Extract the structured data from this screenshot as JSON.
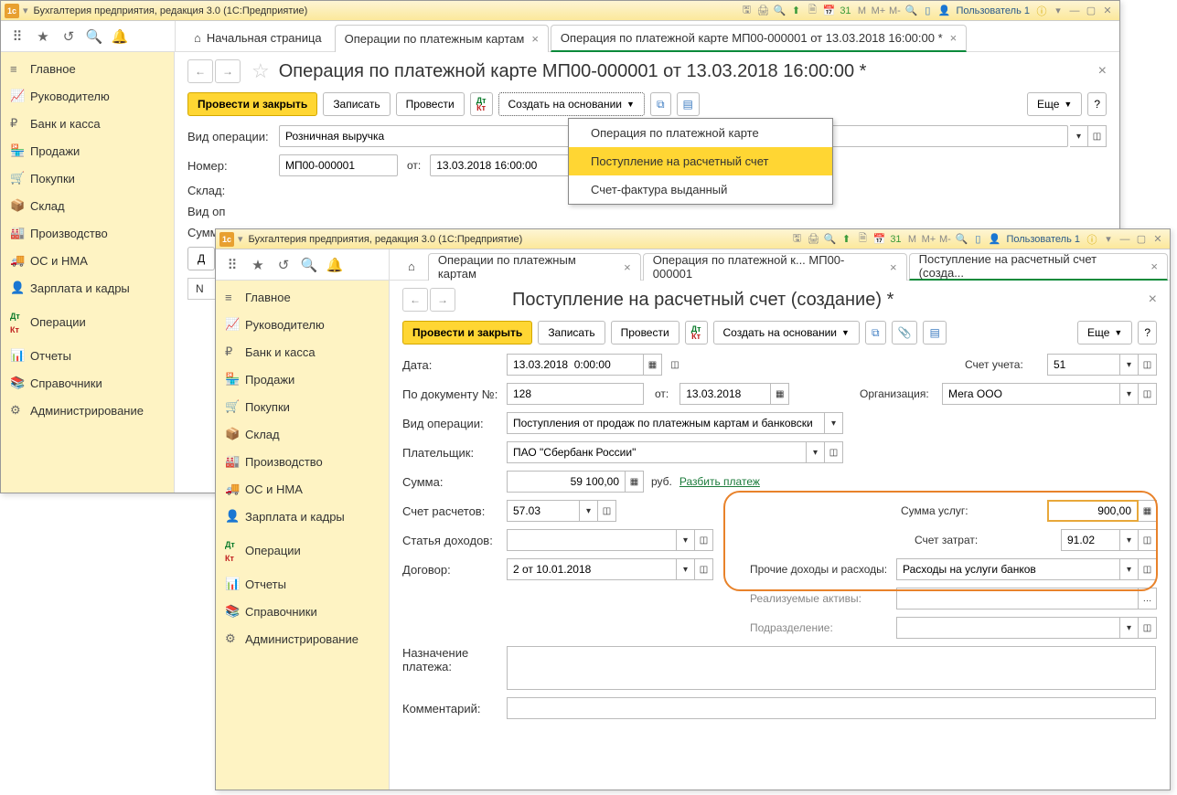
{
  "app_title": "Бухгалтерия предприятия, редакция 3.0  (1С:Предприятие)",
  "user": "Пользователь 1",
  "sidebar": {
    "items": [
      {
        "icon": "≡",
        "label": "Главное"
      },
      {
        "icon": "📈",
        "label": "Руководителю"
      },
      {
        "icon": "₽",
        "label": "Банк и касса"
      },
      {
        "icon": "🏪",
        "label": "Продажи"
      },
      {
        "icon": "🛒",
        "label": "Покупки"
      },
      {
        "icon": "📦",
        "label": "Склад"
      },
      {
        "icon": "🏭",
        "label": "Производство"
      },
      {
        "icon": "🚚",
        "label": "ОС и НМА"
      },
      {
        "icon": "👤",
        "label": "Зарплата и кадры"
      },
      {
        "icon": "Дт",
        "label": "Операции"
      },
      {
        "icon": "📊",
        "label": "Отчеты"
      },
      {
        "icon": "📚",
        "label": "Справочники"
      },
      {
        "icon": "⚙",
        "label": "Администрирование"
      }
    ]
  },
  "win1": {
    "tabs": {
      "home": "Начальная страница",
      "t1": "Операции по платежным картам",
      "t2": "Операция по платежной карте МП00-000001 от 13.03.2018 16:00:00 *"
    },
    "page_title": "Операция по платежной карте МП00-000001 от 13.03.2018 16:00:00 *",
    "actions": {
      "primary": "Провести и закрыть",
      "record": "Записать",
      "post": "Провести",
      "create_based": "Создать на основании",
      "more": "Еще"
    },
    "dropdown": {
      "i1": "Операция по платежной карте",
      "i2": "Поступление на расчетный счет",
      "i3": "Счет-фактура выданный"
    },
    "form": {
      "op_type_lbl": "Вид операции:",
      "op_type": "Розничная выручка",
      "num_lbl": "Номер:",
      "num": "МП00-000001",
      "from_lbl": "от:",
      "date": "13.03.2018 16:00:00",
      "sklad_lbl": "Склад:",
      "vidop_lbl": "Вид оп",
      "sum_lbl": "Сумм",
      "n_col": "N"
    }
  },
  "win2": {
    "tabs": {
      "t1": "Операции по платежным картам",
      "t2": "Операция по платежной к...  МП00-000001",
      "t3": "Поступление на расчетный счет (созда..."
    },
    "page_title": "Поступление на расчетный счет (создание) *",
    "actions": {
      "primary": "Провести и закрыть",
      "record": "Записать",
      "post": "Провести",
      "create_based": "Создать на основании",
      "more": "Еще"
    },
    "form": {
      "date_lbl": "Дата:",
      "date": "13.03.2018  0:00:00",
      "acct_lbl": "Счет учета:",
      "acct": "51",
      "docnum_lbl": "По документу №:",
      "docnum": "128",
      "from_lbl": "от:",
      "docdate": "13.03.2018",
      "org_lbl": "Организация:",
      "org": "Мега ООО",
      "op_lbl": "Вид операции:",
      "op": "Поступления от продаж по платежным картам и банковски",
      "payer_lbl": "Плательщик:",
      "payer": "ПАО \"Сбербанк России\"",
      "sum_lbl": "Сумма:",
      "sum": "59 100,00",
      "rub": "руб.",
      "split": "Разбить платеж",
      "settl_lbl": "Счет расчетов:",
      "settl": "57.03",
      "srv_sum_lbl": "Сумма услуг:",
      "srv_sum": "900,00",
      "cost_lbl": "Счет затрат:",
      "cost": "91.02",
      "income_lbl": "Статья доходов:",
      "other_lbl": "Прочие доходы и расходы:",
      "other": "Расходы на услуги банков",
      "contract_lbl": "Договор:",
      "contract": "2 от 10.01.2018",
      "assets_lbl": "Реализуемые активы:",
      "dept_lbl": "Подразделение:",
      "purpose_lbl": "Назначение платежа:",
      "comment_lbl": "Комментарий:"
    }
  }
}
